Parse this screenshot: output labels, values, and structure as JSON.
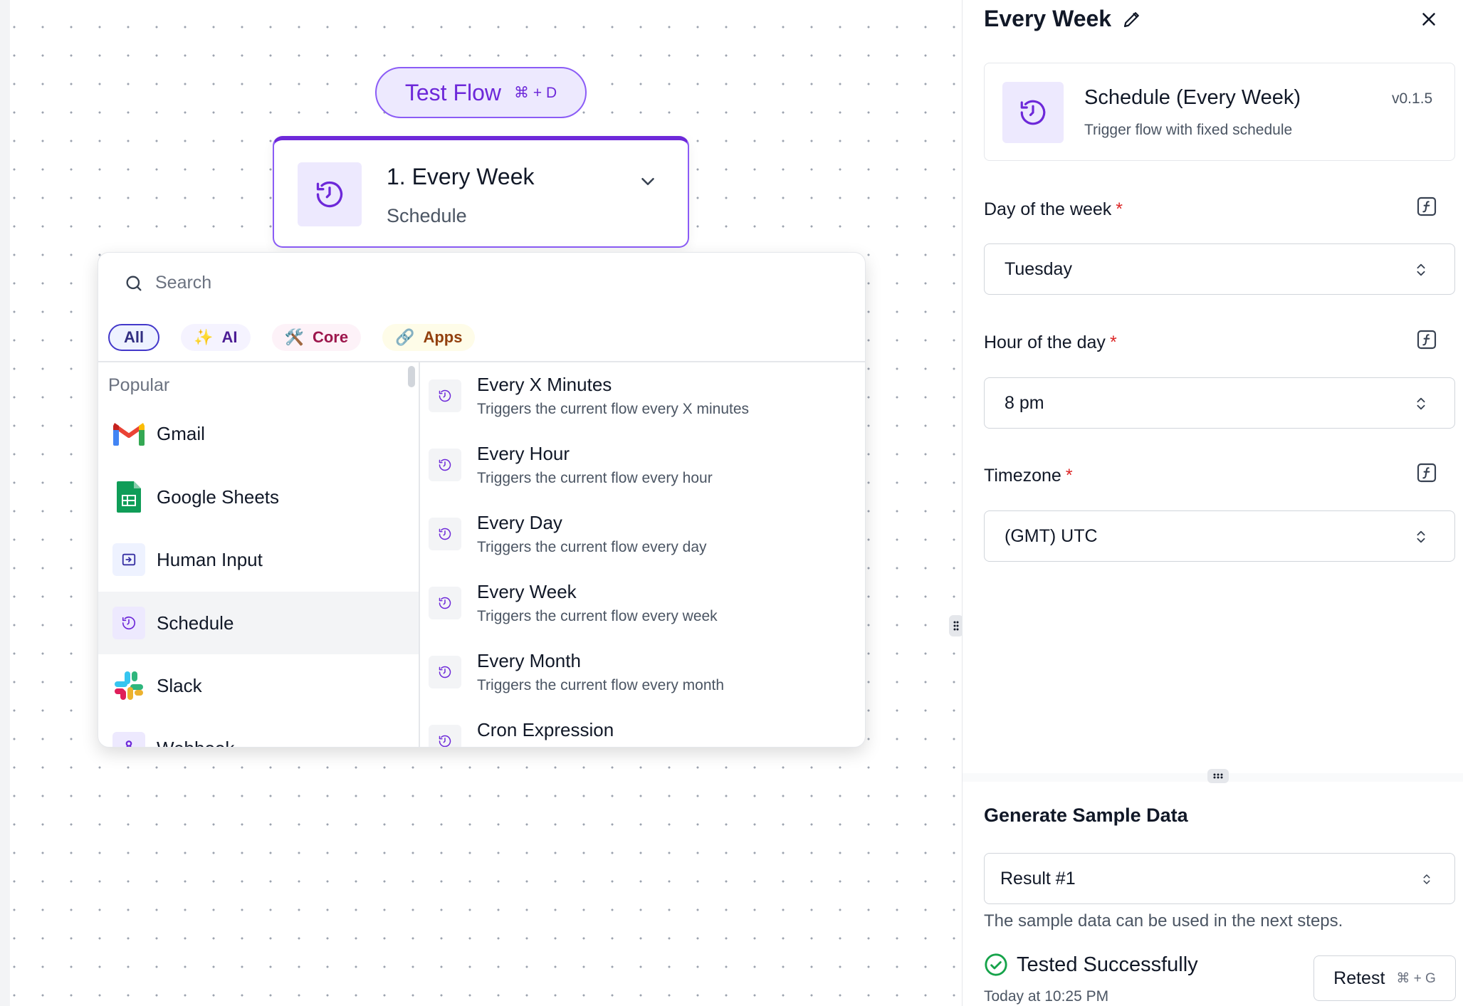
{
  "canvas": {
    "test_flow": {
      "label": "Test Flow",
      "shortcut": "⌘ + D"
    },
    "trigger_node": {
      "title": "1. Every Week",
      "subtitle": "Schedule"
    }
  },
  "picker": {
    "search_placeholder": "Search",
    "filters": [
      {
        "label": "All",
        "icon": "",
        "active": true
      },
      {
        "label": "AI",
        "icon": "✨"
      },
      {
        "label": "Core",
        "icon": "🛠️"
      },
      {
        "label": "Apps",
        "icon": "🔗"
      }
    ],
    "popular_label": "Popular",
    "pieces": [
      {
        "name": "Gmail",
        "icon": "gmail-icon"
      },
      {
        "name": "Google Sheets",
        "icon": "google-sheets-icon"
      },
      {
        "name": "Human Input",
        "icon": "human-input-icon"
      },
      {
        "name": "Schedule",
        "icon": "schedule-icon",
        "selected": true
      },
      {
        "name": "Slack",
        "icon": "slack-icon"
      },
      {
        "name": "Webhook",
        "icon": "webhook-icon"
      }
    ],
    "actions": [
      {
        "name": "Every X Minutes",
        "desc": "Triggers the current flow every X minutes"
      },
      {
        "name": "Every Hour",
        "desc": "Triggers the current flow every hour"
      },
      {
        "name": "Every Day",
        "desc": "Triggers the current flow every day"
      },
      {
        "name": "Every Week",
        "desc": "Triggers the current flow every week"
      },
      {
        "name": "Every Month",
        "desc": "Triggers the current flow every month"
      },
      {
        "name": "Cron Expression",
        "desc": ""
      }
    ]
  },
  "panel": {
    "title": "Every Week",
    "card": {
      "name": "Schedule (Every Week)",
      "desc": "Trigger flow with fixed schedule",
      "version": "v0.1.5"
    },
    "fields": {
      "day": {
        "label": "Day of the week",
        "required": "*",
        "value": "Tuesday"
      },
      "hour": {
        "label": "Hour of the day",
        "required": "*",
        "value": "8 pm"
      },
      "timezone": {
        "label": "Timezone",
        "required": "*",
        "value": "(GMT) UTC"
      }
    },
    "sample": {
      "title": "Generate Sample Data",
      "result": "Result #1",
      "note": "The sample data can be used in the next steps.",
      "status": "Tested Successfully",
      "time": "Today at 10:25 PM",
      "retest_label": "Retest",
      "retest_shortcut": "⌘ + G"
    }
  },
  "colors": {
    "accent": "#6d28d9",
    "accent_light": "#ede9fe",
    "success": "#16a34a",
    "required": "#dc2626"
  }
}
